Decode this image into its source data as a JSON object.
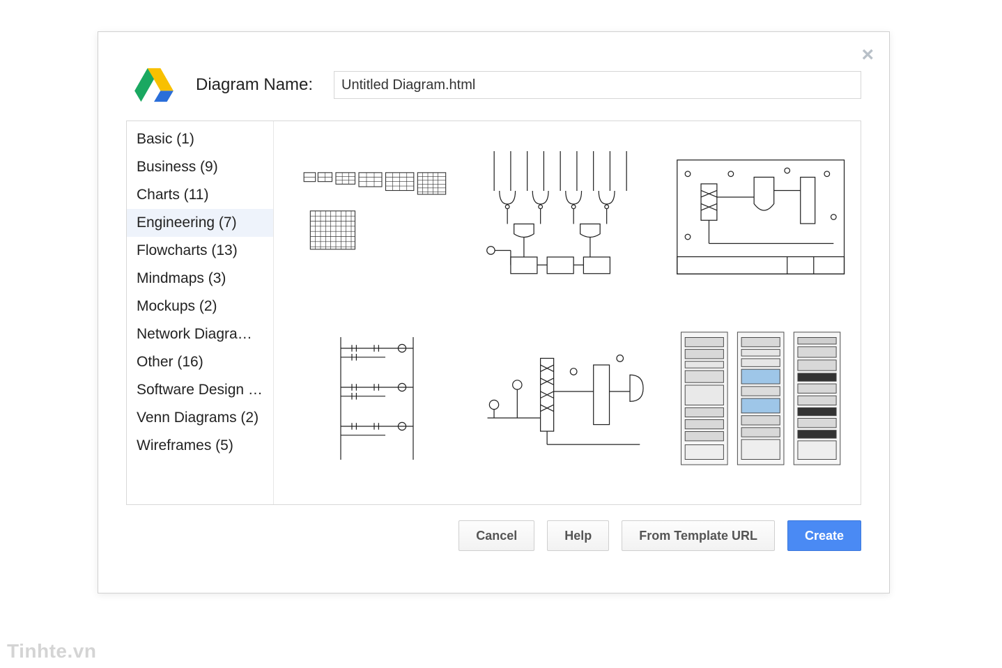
{
  "dialog": {
    "name_label": "Diagram Name:",
    "name_value": "Untitled Diagram.html"
  },
  "sidebar": {
    "items": [
      {
        "label": "Basic (1)"
      },
      {
        "label": "Business (9)"
      },
      {
        "label": "Charts (11)"
      },
      {
        "label": "Engineering (7)",
        "selected": true
      },
      {
        "label": "Flowcharts (13)"
      },
      {
        "label": "Mindmaps (3)"
      },
      {
        "label": "Mockups (2)"
      },
      {
        "label": "Network Diagram…"
      },
      {
        "label": "Other (16)"
      },
      {
        "label": "Software Design (…"
      },
      {
        "label": "Venn Diagrams (2)"
      },
      {
        "label": "Wireframes (5)"
      }
    ]
  },
  "templates": [
    {
      "id": "grids",
      "icon": "grids-icon"
    },
    {
      "id": "logic-circuit",
      "icon": "logic-circuit-icon"
    },
    {
      "id": "process-plant",
      "icon": "process-plant-icon"
    },
    {
      "id": "ladder-logic",
      "icon": "ladder-logic-icon"
    },
    {
      "id": "piping",
      "icon": "piping-icon"
    },
    {
      "id": "server-racks",
      "icon": "server-racks-icon"
    }
  ],
  "footer": {
    "cancel": "Cancel",
    "help": "Help",
    "from_url": "From Template URL",
    "create": "Create"
  },
  "watermark": "Tinhte.vn",
  "colors": {
    "primary": "#4a8af4",
    "selected_bg": "#eef3fb"
  }
}
